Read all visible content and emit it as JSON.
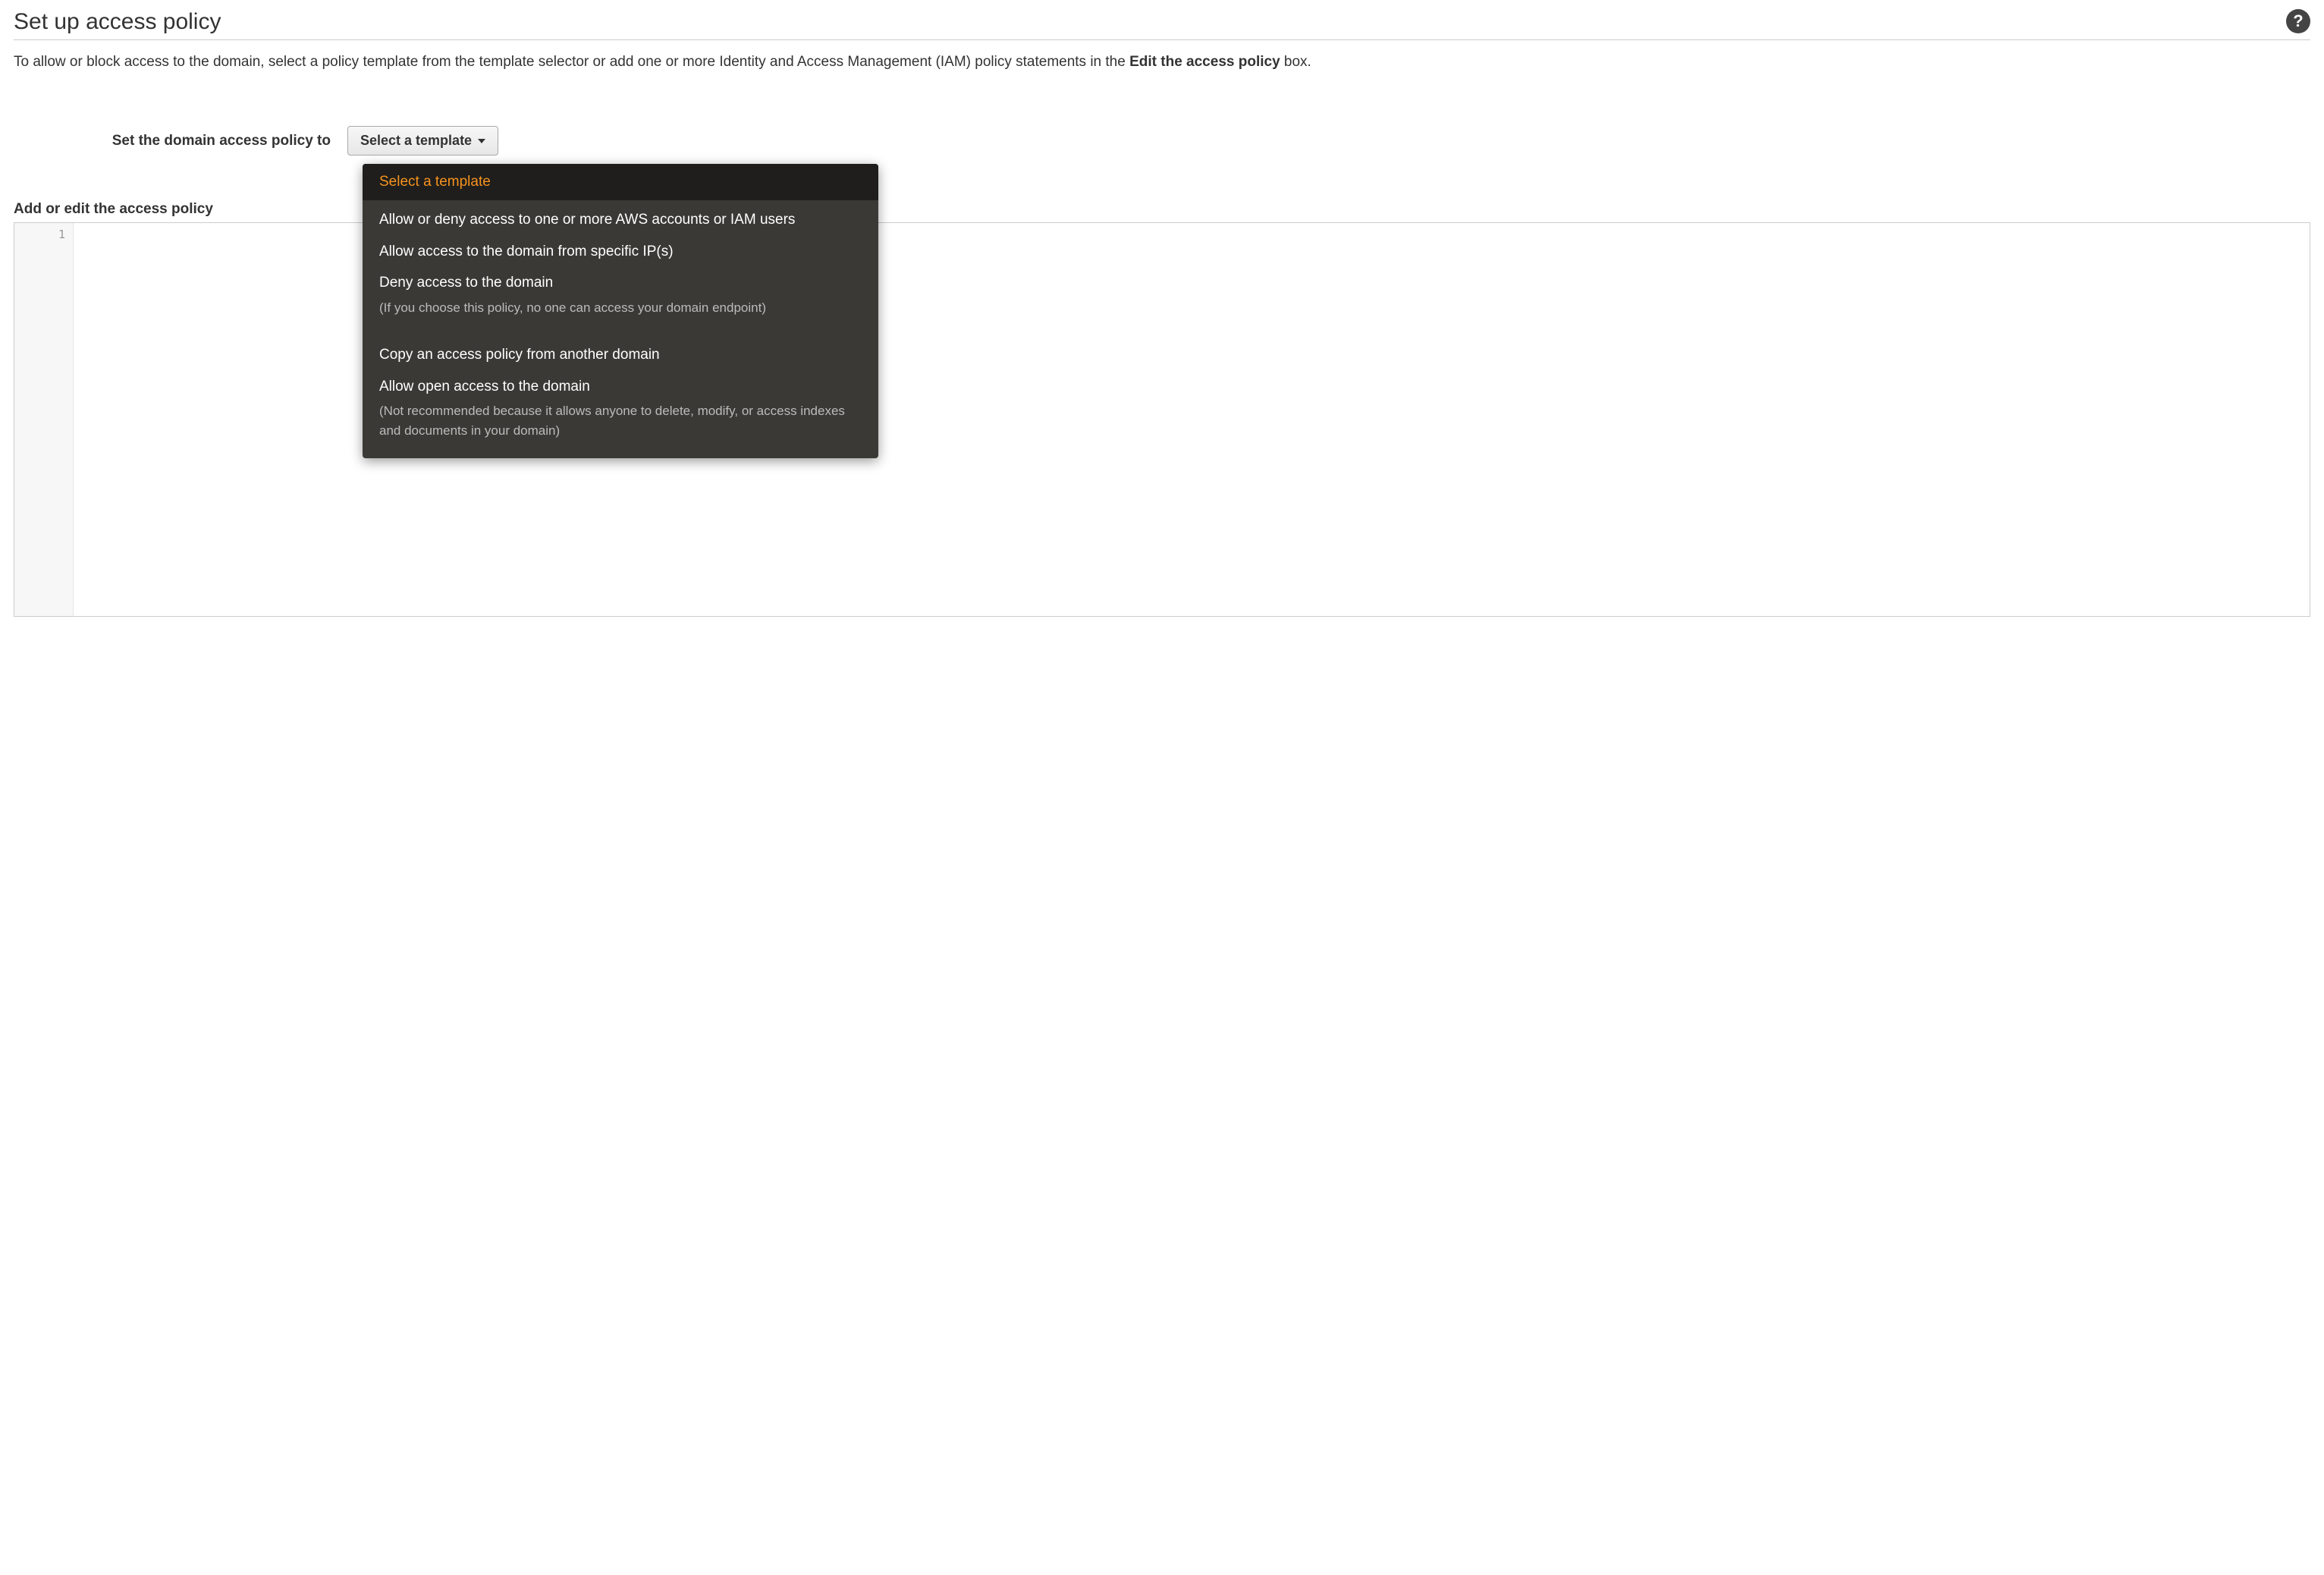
{
  "header": {
    "title": "Set up access policy"
  },
  "description": {
    "prefix": "To allow or block access to the domain, select a policy template from the template selector or add one or more Identity and Access Management (IAM) policy statements in the ",
    "bold": "Edit the access policy",
    "suffix": " box."
  },
  "form": {
    "label": "Set the domain access policy to",
    "button_label": "Select a template"
  },
  "dropdown": {
    "selected": "Select a template",
    "opt1": "Allow or deny access to one or more AWS accounts or IAM users",
    "opt2": "Allow access to the domain from specific IP(s)",
    "opt3": "Deny access to the domain",
    "opt3_sub": "(If you choose this policy, no one can access your domain endpoint)",
    "opt4": "Copy an access policy from another domain",
    "opt5": "Allow open access to the domain",
    "opt5_sub": "(Not recommended because it allows anyone to delete, modify, or access indexes and documents in your domain)"
  },
  "editor": {
    "label": "Add or edit the access policy",
    "line1": "1",
    "content": ""
  }
}
